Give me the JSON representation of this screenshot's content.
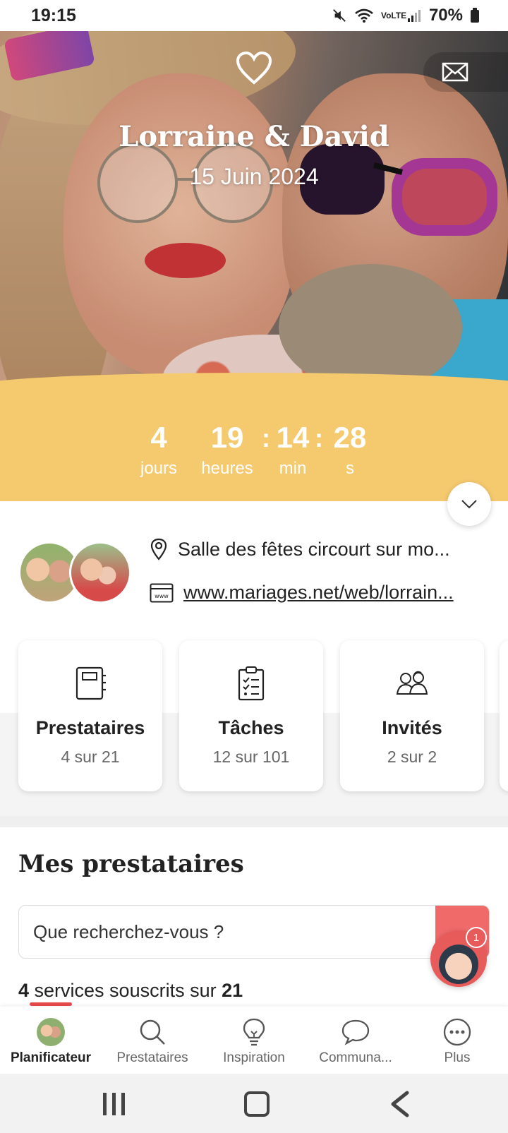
{
  "status_bar": {
    "time": "19:15",
    "network": "VoLTE",
    "battery": "70%"
  },
  "hero": {
    "couple_name": "Lorraine & David",
    "date": "15 Juin 2024"
  },
  "countdown": {
    "days": "4",
    "days_label": "jours",
    "hours": "19",
    "hours_label": "heures",
    "minutes": "14",
    "minutes_label": "min",
    "seconds": "28",
    "seconds_label": "s"
  },
  "info": {
    "location": "Salle des fêtes circourt sur mo...",
    "website": "www.mariages.net/web/lorrain..."
  },
  "cards": [
    {
      "title": "Prestataires",
      "sub": "4 sur 21",
      "icon": "notebook-icon"
    },
    {
      "title": "Tâches",
      "sub": "12 sur 101",
      "icon": "clipboard-checklist-icon"
    },
    {
      "title": "Invités",
      "sub": "2 sur 2",
      "icon": "guests-icon"
    }
  ],
  "vendors": {
    "title": "Mes prestataires",
    "search_placeholder": "Que recherchez-vous ?",
    "count_bold": "4",
    "count_text": " services souscrits sur ",
    "total_bold": "21"
  },
  "chat": {
    "badge": "1"
  },
  "bottom_nav": [
    {
      "label": "Planificateur",
      "active": true
    },
    {
      "label": "Prestataires",
      "active": false
    },
    {
      "label": "Inspiration",
      "active": false
    },
    {
      "label": "Communa...",
      "active": false
    },
    {
      "label": "Plus",
      "active": false
    }
  ],
  "colors": {
    "countdown_bg": "#f5c96e",
    "accent": "#e84b4b"
  }
}
